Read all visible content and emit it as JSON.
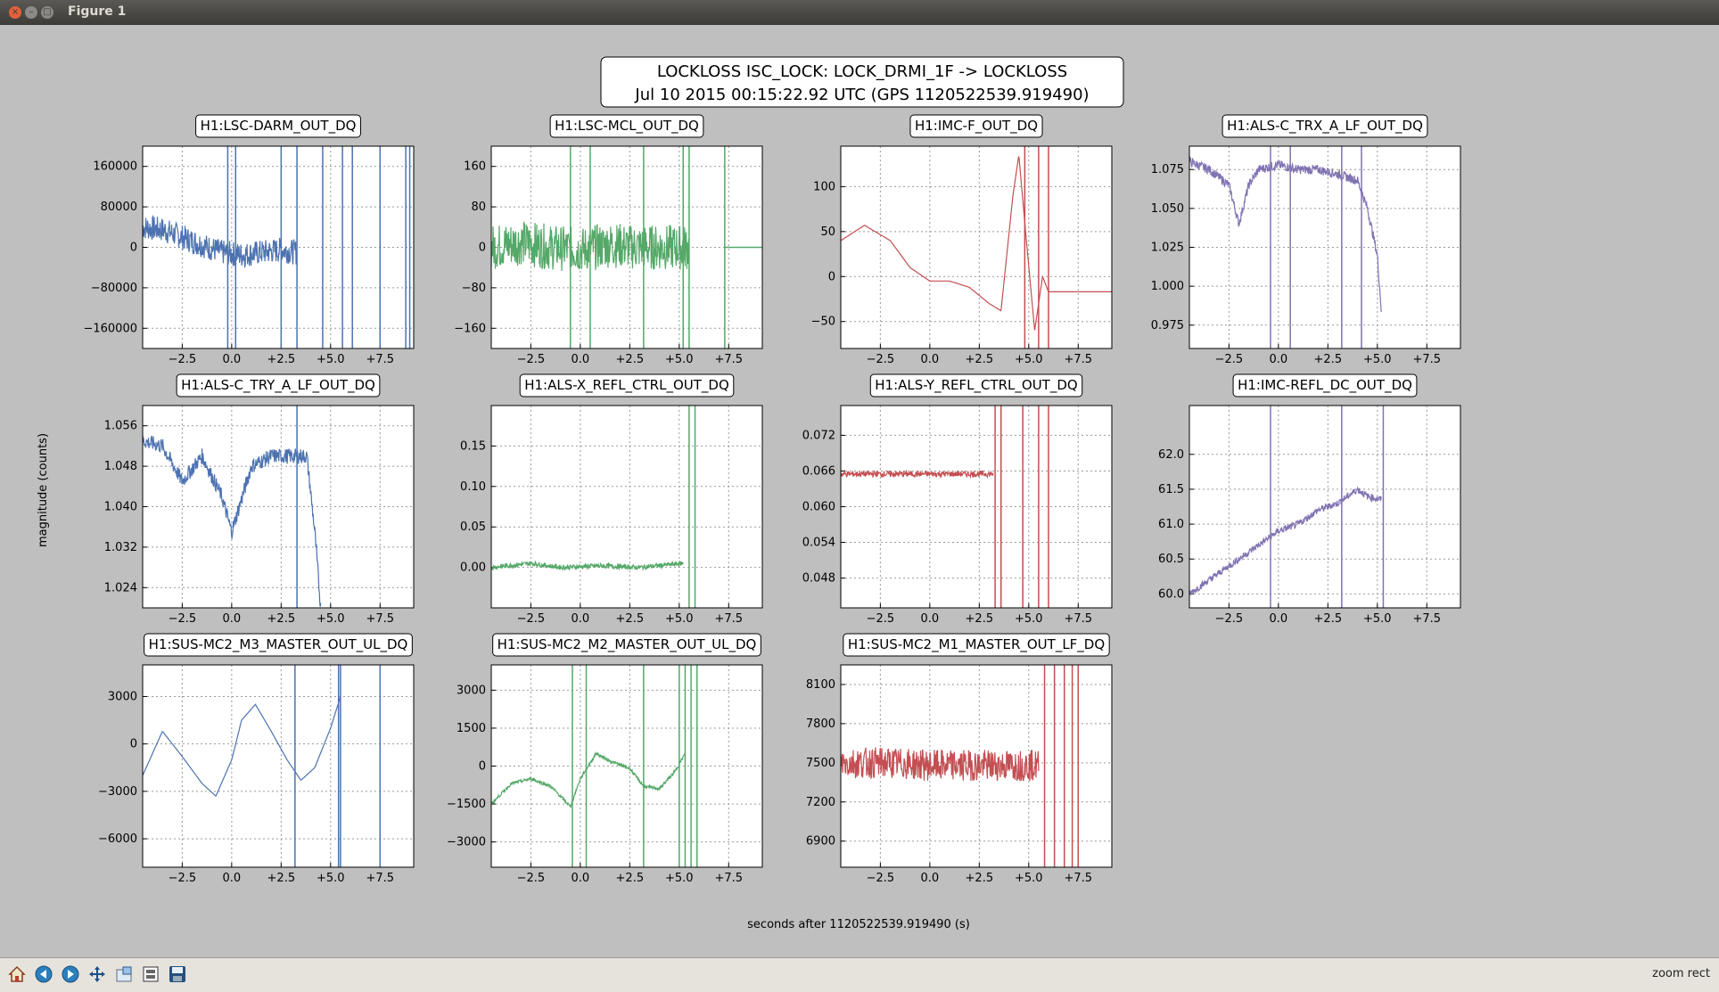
{
  "window": {
    "title": "Figure 1"
  },
  "figure": {
    "title_line1": "LOCKLOSS ISC_LOCK: LOCK_DRMI_1F -> LOCKLOSS",
    "title_line2": "Jul 10 2015 00:15:22.92 UTC (GPS 1120522539.919490)",
    "xlabel": "seconds after 1120522539.919490 (s)",
    "ylabel": "magnitude (counts)"
  },
  "status": "zoom rect",
  "toolbar": [
    "home-icon",
    "back-icon",
    "forward-icon",
    "pan-icon",
    "zoom-icon",
    "subplots-icon",
    "save-icon"
  ],
  "colors": {
    "blue": "#4c72b0",
    "green": "#55a868",
    "red": "#c44e52",
    "purple": "#8172b2"
  },
  "chart_data": [
    {
      "type": "line",
      "title": "H1:LSC-DARM_OUT_DQ",
      "color": "blue",
      "xlim": [
        -4.5,
        9.2
      ],
      "ylim": [
        -200000,
        200000
      ],
      "xticks": [
        -2.5,
        0,
        2.5,
        5,
        7.5
      ],
      "xticklabels": [
        "−2.5",
        "0.0",
        "+2.5",
        "+5.0",
        "+7.5"
      ],
      "yticks": [
        -160000,
        -80000,
        0,
        80000,
        160000
      ],
      "yticklabels": [
        "−160000",
        "−80000",
        "0",
        "80000",
        "160000"
      ],
      "x": [
        -4.5,
        -3.5,
        -2.5,
        -1.5,
        -0.5,
        0.5,
        1.5,
        2.5,
        3.3
      ],
      "y": [
        40000,
        35000,
        20000,
        5000,
        -10000,
        -15000,
        -10000,
        -5000,
        -10000
      ],
      "noise": 25000,
      "vlines": [
        -0.2,
        0.2,
        2.5,
        3.3,
        4.6,
        5.6,
        6.1,
        7.5,
        8.8,
        9.0
      ]
    },
    {
      "type": "line",
      "title": "H1:LSC-MCL_OUT_DQ",
      "color": "green",
      "xlim": [
        -4.5,
        9.2
      ],
      "ylim": [
        -200,
        200
      ],
      "xticks": [
        -2.5,
        0,
        2.5,
        5,
        7.5
      ],
      "xticklabels": [
        "−2.5",
        "0.0",
        "+2.5",
        "+5.0",
        "+7.5"
      ],
      "yticks": [
        -160,
        -80,
        0,
        80,
        160
      ],
      "yticklabels": [
        "−160",
        "−80",
        "0",
        "80",
        "160"
      ],
      "x": [
        -4.5,
        -3,
        -1.5,
        0,
        1.5,
        3,
        4.5,
        5.5
      ],
      "y": [
        0,
        10,
        0,
        -5,
        5,
        0,
        0,
        0
      ],
      "noise": 45,
      "vlines": [
        -0.5,
        0.5,
        3.2,
        5.2,
        5.5,
        7.3
      ],
      "tail": [
        7.3,
        9.2,
        0
      ]
    },
    {
      "type": "line",
      "title": "H1:IMC-F_OUT_DQ",
      "color": "red",
      "xlim": [
        -4.5,
        9.2
      ],
      "ylim": [
        -80,
        145
      ],
      "xticks": [
        -2.5,
        0,
        2.5,
        5,
        7.5
      ],
      "xticklabels": [
        "−2.5",
        "0.0",
        "+2.5",
        "+5.0",
        "+7.5"
      ],
      "yticks": [
        -50,
        0,
        50,
        100
      ],
      "yticklabels": [
        "−50",
        "0",
        "50",
        "100"
      ],
      "x": [
        -4.5,
        -3.3,
        -2,
        -1,
        0,
        1,
        2,
        3,
        3.6,
        4.2,
        4.5,
        4.8,
        5.3,
        5.7,
        6,
        9.2
      ],
      "y": [
        40,
        57,
        40,
        10,
        -5,
        -5,
        -12,
        -30,
        -38,
        90,
        135,
        60,
        -60,
        0,
        -17,
        -17
      ],
      "noise": 0,
      "vlines": [
        4.8,
        5.5,
        6.0
      ]
    },
    {
      "type": "line",
      "title": "H1:ALS-C_TRX_A_LF_OUT_DQ",
      "color": "purple",
      "xlim": [
        -4.5,
        9.2
      ],
      "ylim": [
        0.96,
        1.09
      ],
      "xticks": [
        -2.5,
        0,
        2.5,
        5,
        7.5
      ],
      "xticklabels": [
        "−2.5",
        "0.0",
        "+2.5",
        "+5.0",
        "+7.5"
      ],
      "yticks": [
        0.975,
        1.0,
        1.025,
        1.05,
        1.075
      ],
      "yticklabels": [
        "0.975",
        "1.000",
        "1.025",
        "1.050",
        "1.075"
      ],
      "x": [
        -4.5,
        -3.5,
        -2.5,
        -2,
        -1.5,
        -1,
        0,
        1,
        2,
        3,
        4,
        4.5,
        5,
        5.2
      ],
      "y": [
        1.08,
        1.075,
        1.065,
        1.04,
        1.065,
        1.075,
        1.078,
        1.075,
        1.075,
        1.072,
        1.068,
        1.05,
        1.02,
        0.985
      ],
      "noise": 0.003,
      "vlines": [
        -0.4,
        0.6,
        3.2,
        4.2
      ]
    },
    {
      "type": "line",
      "title": "H1:ALS-C_TRY_A_LF_OUT_DQ",
      "color": "blue",
      "xlim": [
        -4.5,
        9.2
      ],
      "ylim": [
        1.02,
        1.06
      ],
      "xticks": [
        -2.5,
        0,
        2.5,
        5,
        7.5
      ],
      "xticklabels": [
        "−2.5",
        "0.0",
        "+2.5",
        "+5.0",
        "+7.5"
      ],
      "yticks": [
        1.024,
        1.032,
        1.04,
        1.048,
        1.056
      ],
      "yticklabels": [
        "1.024",
        "1.032",
        "1.040",
        "1.048",
        "1.056"
      ],
      "x": [
        -4.5,
        -3.5,
        -2.5,
        -1.5,
        -0.5,
        0,
        1,
        2,
        3,
        3.8,
        4.2,
        4.5
      ],
      "y": [
        1.053,
        1.052,
        1.045,
        1.05,
        1.042,
        1.035,
        1.048,
        1.05,
        1.05,
        1.05,
        1.035,
        1.02
      ],
      "noise": 0.0015,
      "vlines": [
        3.3
      ]
    },
    {
      "type": "line",
      "title": "H1:ALS-X_REFL_CTRL_OUT_DQ",
      "color": "green",
      "xlim": [
        -4.5,
        9.2
      ],
      "ylim": [
        -0.05,
        0.2
      ],
      "xticks": [
        -2.5,
        0,
        2.5,
        5,
        7.5
      ],
      "xticklabels": [
        "−2.5",
        "0.0",
        "+2.5",
        "+5.0",
        "+7.5"
      ],
      "yticks": [
        0,
        0.05,
        0.1,
        0.15
      ],
      "yticklabels": [
        "0.00",
        "0.05",
        "0.10",
        "0.15"
      ],
      "x": [
        -4.5,
        -2.5,
        -1,
        1,
        3,
        5.2
      ],
      "y": [
        0,
        0.005,
        0,
        0.002,
        0,
        0.005
      ],
      "noise": 0.003,
      "vlines": [
        5.5,
        5.8
      ]
    },
    {
      "type": "line",
      "title": "H1:ALS-Y_REFL_CTRL_OUT_DQ",
      "color": "red",
      "xlim": [
        -4.5,
        9.2
      ],
      "ylim": [
        0.043,
        0.077
      ],
      "xticks": [
        -2.5,
        0,
        2.5,
        5,
        7.5
      ],
      "xticklabels": [
        "−2.5",
        "0.0",
        "+2.5",
        "+5.0",
        "+7.5"
      ],
      "yticks": [
        0.048,
        0.054,
        0.06,
        0.066,
        0.072
      ],
      "yticklabels": [
        "0.048",
        "0.054",
        "0.060",
        "0.066",
        "0.072"
      ],
      "x": [
        -4.5,
        -2,
        0,
        2,
        3.2
      ],
      "y": [
        0.0655,
        0.0655,
        0.0655,
        0.0655,
        0.0655
      ],
      "noise": 0.0005,
      "vlines": [
        3.3,
        3.6,
        4.7,
        5.5,
        6.0
      ]
    },
    {
      "type": "line",
      "title": "H1:IMC-REFL_DC_OUT_DQ",
      "color": "purple",
      "xlim": [
        -4.5,
        9.2
      ],
      "ylim": [
        59.8,
        62.7
      ],
      "xticks": [
        -2.5,
        0,
        2.5,
        5,
        7.5
      ],
      "xticklabels": [
        "−2.5",
        "0.0",
        "+2.5",
        "+5.0",
        "+7.5"
      ],
      "yticks": [
        60,
        60.5,
        61,
        61.5,
        62
      ],
      "yticklabels": [
        "60.0",
        "60.5",
        "61.0",
        "61.5",
        "62.0"
      ],
      "x": [
        -4.5,
        -3,
        -1.5,
        0,
        1,
        2,
        3,
        4,
        4.5,
        5.2
      ],
      "y": [
        60.0,
        60.3,
        60.6,
        60.9,
        61.0,
        61.2,
        61.3,
        61.5,
        61.4,
        61.35
      ],
      "noise": 0.05,
      "vlines": [
        -0.4,
        3.2,
        5.3
      ]
    },
    {
      "type": "line",
      "title": "H1:SUS-MC2_M3_MASTER_OUT_UL_DQ",
      "color": "blue",
      "xlim": [
        -4.5,
        9.2
      ],
      "ylim": [
        -7800,
        5000
      ],
      "xticks": [
        -2.5,
        0,
        2.5,
        5,
        7.5
      ],
      "xticklabels": [
        "−2.5",
        "0.0",
        "+2.5",
        "+5.0",
        "+7.5"
      ],
      "yticks": [
        -6000,
        -3000,
        0,
        3000
      ],
      "yticklabels": [
        "−6000",
        "−3000",
        "0",
        "3000"
      ],
      "x": [
        -4.5,
        -3.5,
        -2.5,
        -1.5,
        -0.8,
        0,
        0.5,
        1.2,
        2,
        2.8,
        3.5,
        4.2,
        5,
        5.5
      ],
      "y": [
        -2000,
        800,
        -800,
        -2500,
        -3300,
        -1000,
        1500,
        2500,
        800,
        -1000,
        -2300,
        -1500,
        1000,
        3000
      ],
      "noise": 0,
      "vlines": [
        3.2,
        5.4,
        5.5,
        7.5
      ]
    },
    {
      "type": "line",
      "title": "H1:SUS-MC2_M2_MASTER_OUT_UL_DQ",
      "color": "green",
      "xlim": [
        -4.5,
        9.2
      ],
      "ylim": [
        -4000,
        4000
      ],
      "xticks": [
        -2.5,
        0,
        2.5,
        5,
        7.5
      ],
      "xticklabels": [
        "−2.5",
        "0.0",
        "+2.5",
        "+5.0",
        "+7.5"
      ],
      "yticks": [
        -3000,
        -1500,
        0,
        1500,
        3000
      ],
      "yticklabels": [
        "−3000",
        "−1500",
        "0",
        "1500",
        "3000"
      ],
      "x": [
        -4.5,
        -3.5,
        -2.5,
        -1.5,
        -0.5,
        0,
        0.8,
        1.5,
        2.5,
        3.2,
        4,
        4.8,
        5.3
      ],
      "y": [
        -1500,
        -700,
        -500,
        -800,
        -1600,
        -500,
        500,
        200,
        -100,
        -800,
        -900,
        -200,
        500
      ],
      "noise": 60,
      "vlines": [
        -0.4,
        0.3,
        3.2,
        5.0,
        5.3,
        5.6,
        5.9
      ]
    },
    {
      "type": "line",
      "title": "H1:SUS-MC2_M1_MASTER_OUT_LF_DQ",
      "color": "red",
      "xlim": [
        -4.5,
        9.2
      ],
      "ylim": [
        6700,
        8250
      ],
      "xticks": [
        -2.5,
        0,
        2.5,
        5,
        7.5
      ],
      "xticklabels": [
        "−2.5",
        "0.0",
        "+2.5",
        "+5.0",
        "+7.5"
      ],
      "yticks": [
        6900,
        7200,
        7500,
        7800,
        8100
      ],
      "yticklabels": [
        "6900",
        "7200",
        "7500",
        "7800",
        "8100"
      ],
      "x": [
        -4.5,
        -2,
        0,
        2,
        4,
        5.5
      ],
      "y": [
        7500,
        7500,
        7480,
        7480,
        7480,
        7480
      ],
      "noise": 120,
      "vlines": [
        5.8,
        6.3,
        6.8,
        7.2,
        7.5
      ]
    }
  ]
}
